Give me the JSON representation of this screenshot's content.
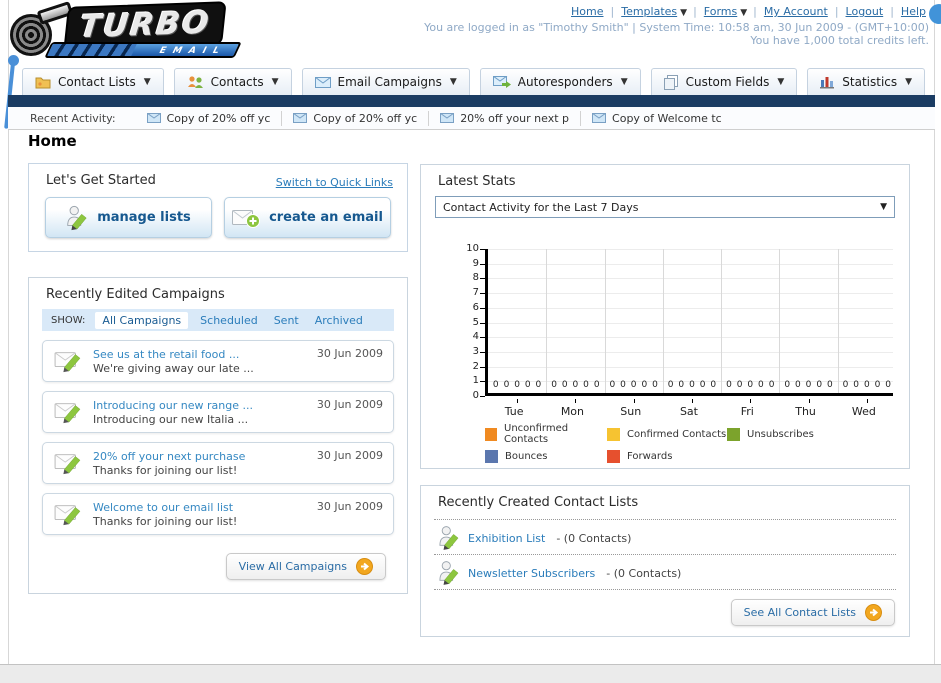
{
  "header": {
    "logo_title": "TURBO",
    "logo_subtitle": "EMAIL",
    "nav_links": [
      {
        "label": "Home",
        "dropdown": false
      },
      {
        "label": "Templates",
        "dropdown": true
      },
      {
        "label": "Forms",
        "dropdown": true
      },
      {
        "label": "My Account",
        "dropdown": false
      },
      {
        "label": "Logout",
        "dropdown": false
      },
      {
        "label": "Help",
        "dropdown": false
      }
    ],
    "login_info": "You are logged in as \"Timothy Smith\" | System Time: 10:58 am, 30 Jun 2009 - (GMT+10:00)",
    "credits_info": "You have 1,000 total credits left."
  },
  "nav_tabs": [
    {
      "label": "Contact Lists",
      "icon": "folder-icon"
    },
    {
      "label": "Contacts",
      "icon": "people-icon"
    },
    {
      "label": "Email Campaigns",
      "icon": "envelope-icon"
    },
    {
      "label": "Autoresponders",
      "icon": "envelope-arrow-icon"
    },
    {
      "label": "Custom Fields",
      "icon": "pages-icon"
    },
    {
      "label": "Statistics",
      "icon": "bar-chart-icon"
    }
  ],
  "recent_activity": {
    "label": "Recent Activity:",
    "items": [
      "Copy of 20% off yc",
      "Copy of 20% off yc",
      "20% off your next p",
      "Copy of Welcome tc"
    ]
  },
  "page_title": "Home",
  "get_started": {
    "title": "Let's Get Started",
    "switch_link": "Switch to Quick Links",
    "manage_lists_label": "manage lists",
    "create_email_label": "create an email"
  },
  "campaigns_panel": {
    "title": "Recently Edited Campaigns",
    "show_label": "SHOW:",
    "filters": [
      "All Campaigns",
      "Scheduled",
      "Sent",
      "Archived"
    ],
    "active_filter": "All Campaigns",
    "items": [
      {
        "title": "See us at the retail food ...",
        "subtitle": "We're giving away our late ...",
        "date": "30 Jun 2009"
      },
      {
        "title": "Introducing our new range ...",
        "subtitle": "Introducing our new Italia ...",
        "date": "30 Jun 2009"
      },
      {
        "title": "20% off your next purchase",
        "subtitle": "Thanks for joining our list!",
        "date": "30 Jun 2009"
      },
      {
        "title": "Welcome to our email list",
        "subtitle": "Thanks for joining our list!",
        "date": "30 Jun 2009"
      }
    ],
    "view_all_label": "View All Campaigns"
  },
  "stats_panel": {
    "title": "Latest Stats",
    "dropdown_value": "Contact Activity for the Last 7 Days"
  },
  "chart_data": {
    "type": "bar",
    "title": "Contact Activity for the Last 7 Days",
    "categories": [
      "Tue",
      "Mon",
      "Sun",
      "Sat",
      "Fri",
      "Thu",
      "Wed"
    ],
    "series": [
      {
        "name": "Unconfirmed Contacts",
        "color": "#F08A21",
        "values": [
          0,
          0,
          0,
          0,
          0,
          0,
          0
        ]
      },
      {
        "name": "Confirmed Contacts",
        "color": "#F6C331",
        "values": [
          0,
          0,
          0,
          0,
          0,
          0,
          0
        ]
      },
      {
        "name": "Unsubscribes",
        "color": "#7CA32C",
        "values": [
          0,
          0,
          0,
          0,
          0,
          0,
          0
        ]
      },
      {
        "name": "Bounces",
        "color": "#5B77AE",
        "values": [
          0,
          0,
          0,
          0,
          0,
          0,
          0
        ]
      },
      {
        "name": "Forwards",
        "color": "#E6502E",
        "values": [
          0,
          0,
          0,
          0,
          0,
          0,
          0
        ]
      }
    ],
    "xlabel": "",
    "ylabel": "",
    "ylim": [
      0,
      10
    ],
    "yticks": [
      0,
      1,
      2,
      3,
      4,
      5,
      6,
      7,
      8,
      9,
      10
    ],
    "grid": true,
    "legend_position": "bottom"
  },
  "contact_lists_panel": {
    "title": "Recently Created Contact Lists",
    "items": [
      {
        "name": "Exhibition List",
        "suffix": "- (0 Contacts)"
      },
      {
        "name": "Newsletter Subscribers",
        "suffix": "- (0 Contacts)"
      }
    ],
    "see_all_label": "See All Contact Lists"
  }
}
